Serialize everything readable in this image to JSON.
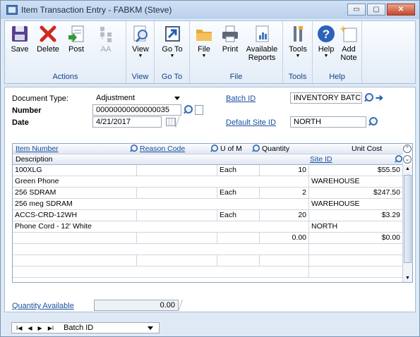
{
  "window": {
    "title": "Item Transaction Entry  -  FABKM (Steve)",
    "minimize_label": "▭",
    "maximize_label": "▢",
    "close_label": "✕"
  },
  "ribbon": {
    "groups": [
      {
        "label": "Actions",
        "buttons": [
          {
            "label": "Save",
            "icon": "save-icon"
          },
          {
            "label": "Delete",
            "icon": "delete-icon"
          },
          {
            "label": "Post",
            "icon": "post-icon"
          },
          {
            "label": "AA",
            "icon": "aa-icon",
            "disabled": true
          }
        ]
      },
      {
        "label": "View",
        "buttons": [
          {
            "label": "View",
            "icon": "view-icon",
            "dropdown": true
          }
        ]
      },
      {
        "label": "Go To",
        "buttons": [
          {
            "label": "Go To",
            "icon": "goto-icon",
            "dropdown": true
          }
        ]
      },
      {
        "label": "File",
        "buttons": [
          {
            "label": "File",
            "icon": "folder-icon",
            "dropdown": true
          },
          {
            "label": "Print",
            "icon": "print-icon"
          },
          {
            "label": "Available",
            "label2": "Reports",
            "icon": "reports-icon",
            "dropdown": true
          }
        ]
      },
      {
        "label": "Tools",
        "buttons": [
          {
            "label": "Tools",
            "icon": "tools-icon",
            "dropdown": true
          }
        ]
      },
      {
        "label": "Help",
        "buttons": [
          {
            "label": "Help",
            "icon": "help-icon",
            "dropdown": true
          },
          {
            "label": "Add",
            "label2": "Note",
            "icon": "note-icon"
          }
        ]
      }
    ]
  },
  "header": {
    "document_type_label": "Document Type:",
    "document_type_value": "Adjustment",
    "number_label": "Number",
    "number_value": "00000000000000035",
    "date_label": "Date",
    "date_value": "4/21/2017",
    "batch_id_label": "Batch ID",
    "batch_id_value": "INVENTORY BATCH",
    "default_site_label": "Default Site ID",
    "default_site_value": "NORTH"
  },
  "grid": {
    "columns": {
      "item_number": "Item Number",
      "reason_code": "Reason Code",
      "u_of_m": "U of M",
      "quantity": "Quantity",
      "unit_cost": "Unit Cost",
      "description": "Description",
      "site_id": "Site ID"
    },
    "rows": [
      {
        "item": "100XLG",
        "reason": "",
        "uom": "Each",
        "qty": "10",
        "cost": "$55.50",
        "desc": "Green Phone",
        "site": "WAREHOUSE"
      },
      {
        "item": "256 SDRAM",
        "reason": "",
        "uom": "Each",
        "qty": "2",
        "cost": "$247.50",
        "desc": "256 meg SDRAM",
        "site": "WAREHOUSE"
      },
      {
        "item": "ACCS-CRD-12WH",
        "reason": "",
        "uom": "Each",
        "qty": "20",
        "cost": "$3.29",
        "desc": "Phone Cord - 12' White",
        "site": "NORTH"
      },
      {
        "item": "",
        "reason": "",
        "uom": "",
        "qty": "0.00",
        "cost": "$0.00",
        "desc": "",
        "site": ""
      }
    ]
  },
  "footer": {
    "quantity_available_label": "Quantity Available",
    "quantity_available_value": "0.00",
    "nav_sort_value": "Batch ID",
    "nav_first": "I◀",
    "nav_prev": "◀",
    "nav_next": "▶",
    "nav_last": "▶I"
  }
}
